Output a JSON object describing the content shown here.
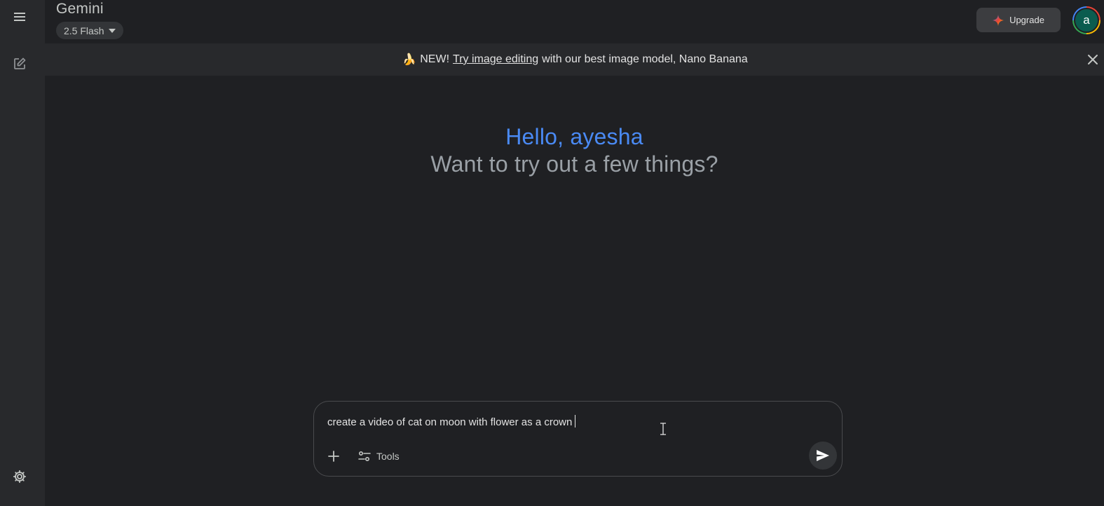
{
  "app": {
    "title": "Gemini",
    "model_label": "2.5 Flash"
  },
  "rail": {
    "menu_icon": "hamburger-menu-icon",
    "new_chat_icon": "edit-square-icon",
    "settings_icon": "gear-icon"
  },
  "header": {
    "upgrade_label": "Upgrade",
    "avatar_initial": "a"
  },
  "banner": {
    "emoji": "🍌",
    "prefix": "NEW!",
    "link": "Try image editing",
    "suffix": "with our best image model, Nano Banana"
  },
  "greeting": {
    "hello": "Hello, ayesha",
    "sub": "Want to try out a few things?"
  },
  "composer": {
    "value": "create a video of cat on moon with flower as a crown",
    "tools_label": "Tools"
  },
  "colors": {
    "background": "#1f2023",
    "rail": "#28292c",
    "accent_blue": "#4a8af4",
    "muted_text": "#9aa0a6"
  }
}
